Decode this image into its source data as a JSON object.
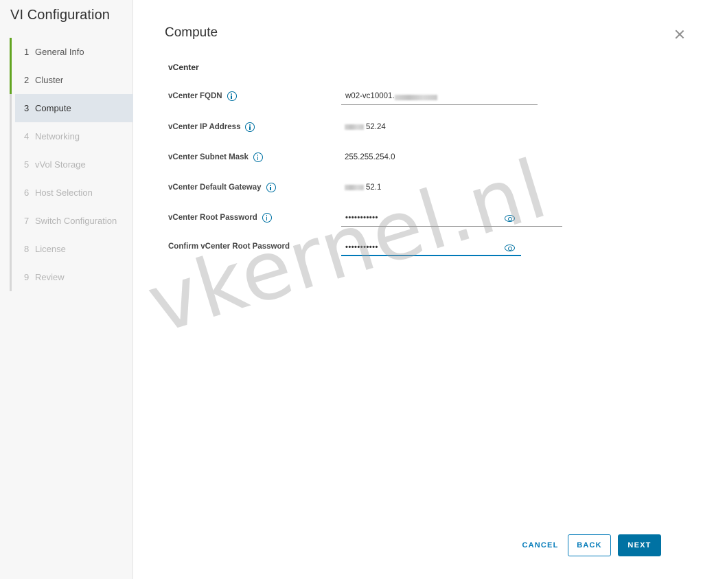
{
  "wizard": {
    "title": "VI Configuration",
    "steps": [
      {
        "num": "1",
        "label": "General Info",
        "state": "done"
      },
      {
        "num": "2",
        "label": "Cluster",
        "state": "done"
      },
      {
        "num": "3",
        "label": "Compute",
        "state": "current"
      },
      {
        "num": "4",
        "label": "Networking",
        "state": "disabled"
      },
      {
        "num": "5",
        "label": "vVol Storage",
        "state": "disabled"
      },
      {
        "num": "6",
        "label": "Host Selection",
        "state": "disabled"
      },
      {
        "num": "7",
        "label": "Switch Configuration",
        "state": "disabled"
      },
      {
        "num": "8",
        "label": "License",
        "state": "disabled"
      },
      {
        "num": "9",
        "label": "Review",
        "state": "disabled"
      }
    ]
  },
  "page": {
    "title": "Compute",
    "section": "vCenter"
  },
  "fields": {
    "fqdn": {
      "label": "vCenter FQDN",
      "value": "w02-vc10001."
    },
    "ip": {
      "label": "vCenter IP Address",
      "value": "52.24"
    },
    "subnet": {
      "label": "vCenter Subnet Mask",
      "value": "255.255.254.0"
    },
    "gateway": {
      "label": "vCenter Default Gateway",
      "value": "52.1"
    },
    "root_password": {
      "label": "vCenter Root Password",
      "value": "•••••••••••"
    },
    "confirm_password": {
      "label": "Confirm vCenter Root Password",
      "value": "•••••••••••"
    }
  },
  "footer": {
    "cancel": "CANCEL",
    "back": "BACK",
    "next": "NEXT"
  },
  "watermark": "vkernel.nl",
  "colors": {
    "accent": "#0072a3",
    "done": "#62a420",
    "current_bg": "#dfe5eb"
  }
}
